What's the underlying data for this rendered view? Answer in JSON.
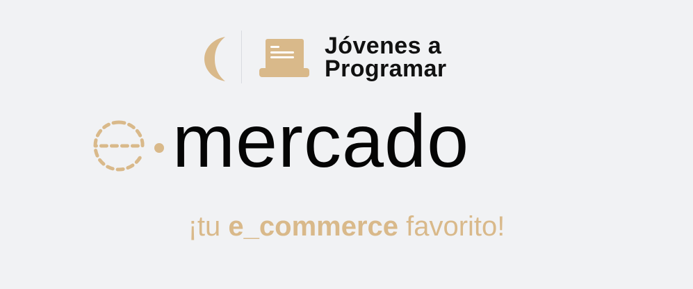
{
  "brand": {
    "line1": "Jóvenes a",
    "line2": "Programar"
  },
  "title": {
    "word": "mercado"
  },
  "tagline": {
    "prefix": "¡tu ",
    "emphasis": "e_commerce",
    "suffix": " favorito!"
  },
  "colors": {
    "background": "#f1f2f4",
    "gold": "#d9b98a",
    "text": "#050505",
    "divider": "#d8dbe0"
  },
  "icons": {
    "brand_left": "crescent-moon-icon",
    "brand_right": "laptop-icon",
    "title_letter": "dashed-e-icon"
  }
}
